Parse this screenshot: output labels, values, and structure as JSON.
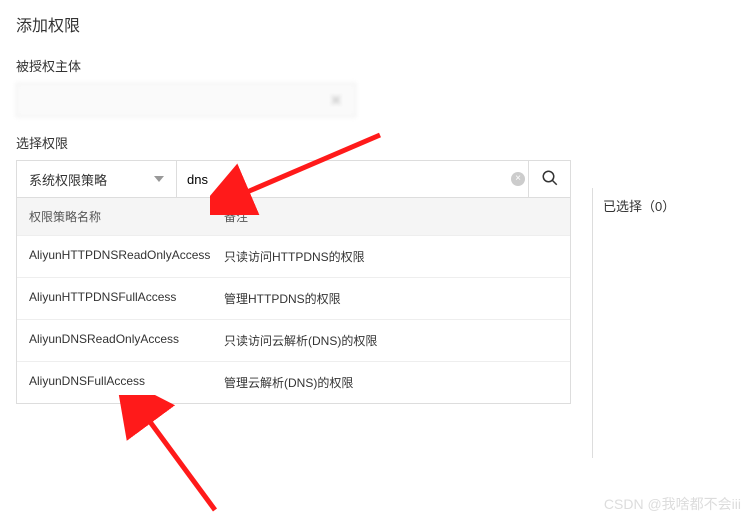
{
  "page": {
    "title": "添加权限"
  },
  "subject": {
    "label": "被授权主体"
  },
  "permissions": {
    "label": "选择权限",
    "dropdown": {
      "selected": "系统权限策略"
    },
    "search": {
      "value": "dns"
    },
    "columns": {
      "name": "权限策略名称",
      "remark": "备注"
    },
    "rows": [
      {
        "name": "AliyunHTTPDNSReadOnlyAccess",
        "remark": "只读访问HTTPDNS的权限"
      },
      {
        "name": "AliyunHTTPDNSFullAccess",
        "remark": "管理HTTPDNS的权限"
      },
      {
        "name": "AliyunDNSReadOnlyAccess",
        "remark": "只读访问云解析(DNS)的权限"
      },
      {
        "name": "AliyunDNSFullAccess",
        "remark": "管理云解析(DNS)的权限"
      }
    ]
  },
  "selected": {
    "label": "已选择（0）",
    "count": 0
  },
  "watermark": "CSDN @我啥都不会iii"
}
